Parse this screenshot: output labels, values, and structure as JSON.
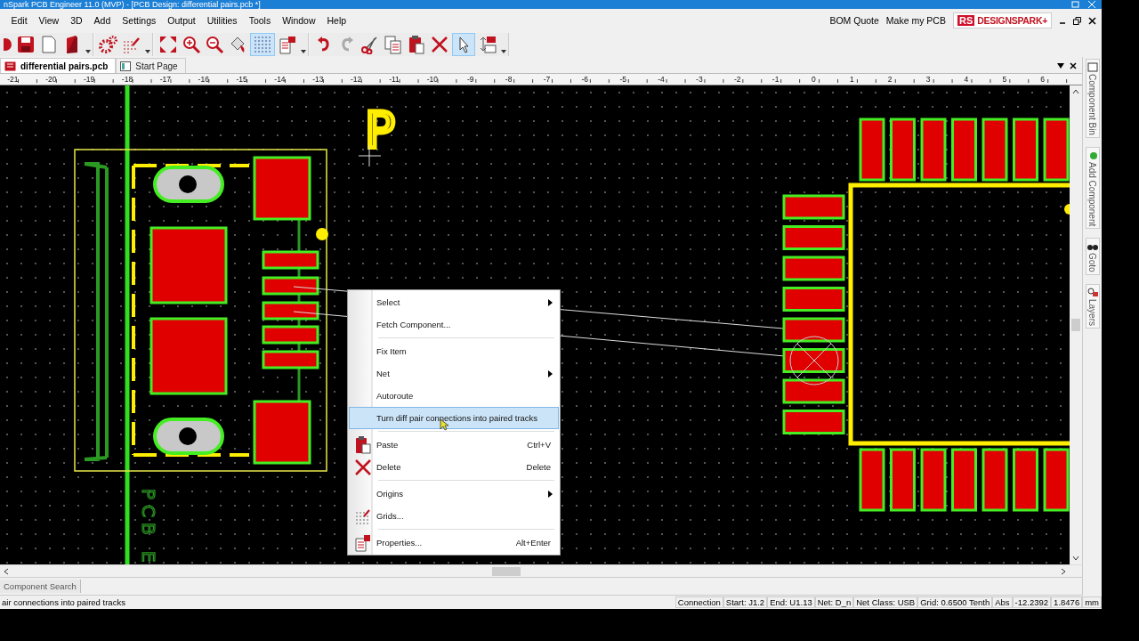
{
  "window": {
    "title": "nSpark PCB Engineer 11.0  (MVP) - [PCB Design: differential pairs.pcb *]"
  },
  "menu": [
    "Edit",
    "View",
    "3D",
    "Add",
    "Settings",
    "Output",
    "Utilities",
    "Tools",
    "Window",
    "Help"
  ],
  "header_links": [
    "BOM Quote",
    "Make my PCB"
  ],
  "logo": {
    "badge": "RS",
    "name": "DESIGNSPARK+"
  },
  "toolbar": {
    "grid_on": true,
    "select_on": true
  },
  "tabs": [
    {
      "label": "differential pairs.pcb",
      "selected": true
    },
    {
      "label": "Start Page",
      "selected": false
    }
  ],
  "ruler": [
    "-21",
    "-20",
    "-19",
    "-18",
    "-17",
    "-16",
    "-15",
    "-14",
    "-13",
    "-12",
    "-11",
    "-10",
    "-9",
    "-8",
    "-7",
    "-6",
    "-5",
    "-4",
    "-3",
    "-2",
    "-1",
    "0",
    "1",
    "2",
    "3",
    "4",
    "5",
    "6"
  ],
  "canvas": {
    "silkscreen_letter": "P",
    "board_label": "PCB E"
  },
  "context_menu": [
    {
      "kind": "item",
      "label": "Select",
      "submenu": true,
      "selected": false
    },
    {
      "kind": "item",
      "label": "Fetch Component...",
      "submenu": false,
      "selected": false
    },
    {
      "kind": "separator"
    },
    {
      "kind": "item",
      "label": "Fix Item",
      "submenu": false,
      "selected": false
    },
    {
      "kind": "item",
      "label": "Net",
      "submenu": true,
      "selected": false
    },
    {
      "kind": "item",
      "label": "Autoroute",
      "submenu": false,
      "selected": false
    },
    {
      "kind": "item",
      "label": "Turn diff pair connections into paired tracks",
      "submenu": false,
      "selected": true
    },
    {
      "kind": "separator"
    },
    {
      "kind": "item",
      "label": "Paste",
      "shortcut": "Ctrl+V",
      "submenu": false,
      "selected": false
    },
    {
      "kind": "item",
      "label": "Delete",
      "shortcut": "Delete",
      "submenu": false,
      "selected": false
    },
    {
      "kind": "separator"
    },
    {
      "kind": "item",
      "label": "Origins",
      "submenu": true,
      "selected": false
    },
    {
      "kind": "item",
      "label": "Grids...",
      "submenu": false,
      "selected": false
    },
    {
      "kind": "separator"
    },
    {
      "kind": "item",
      "label": "Properties...",
      "shortcut": "Alt+Enter",
      "submenu": false,
      "selected": false
    }
  ],
  "side_panel": [
    "Component Bin",
    "Add Component",
    "Goto",
    "Layers"
  ],
  "bottom_tabs": [
    "Component Search"
  ],
  "status": {
    "message": "air connections into paired tracks",
    "fields": [
      "Connection",
      "Start: J1.2",
      "End: U1.13",
      "Net: D_n",
      "Net Class: USB",
      "Grid: 0.6500 Tenth",
      "Abs",
      "-12.2392",
      "1.8476",
      "mm"
    ]
  }
}
